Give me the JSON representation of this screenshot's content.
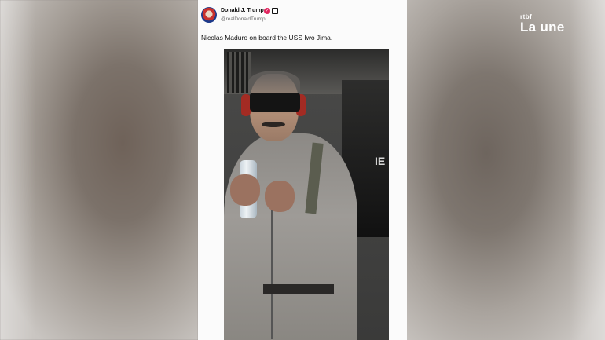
{
  "tweet": {
    "author_name": "Donald J. Trump",
    "handle": "@realDonaldTrump",
    "text": "Nicolas Maduro on board the USS Iwo Jima.",
    "verified_badge_color": "#e0245e"
  },
  "logo": {
    "small_text": "rtbf",
    "big_text": "La une",
    "color": "#ffffff"
  },
  "photo": {
    "panel_text": "IE"
  },
  "icons": {
    "verified": "verified-badge-icon",
    "affiliation": "affiliation-icon"
  }
}
